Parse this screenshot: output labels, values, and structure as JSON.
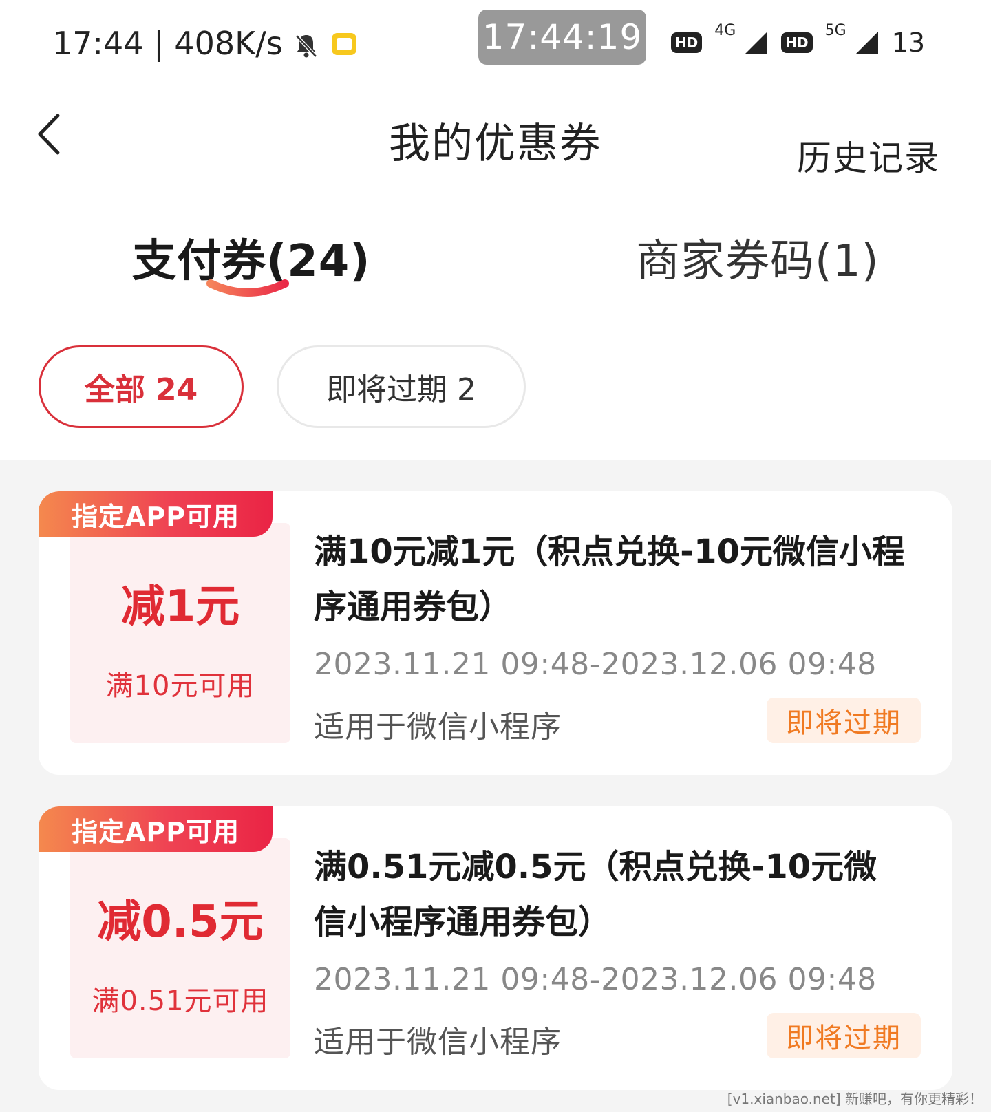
{
  "status_bar": {
    "time_speed": "17:44 | 408K/s",
    "clock": "17:44:19",
    "hd_1": "HD",
    "net_1": "4G",
    "hd_2": "HD",
    "net_2": "5G",
    "battery": "13",
    "icons": [
      "bell-muted-icon",
      "note-icon",
      "signal-icon"
    ]
  },
  "header": {
    "title": "我的优惠券",
    "history": "历史记录",
    "back_icon": "chevron-left-icon"
  },
  "tabs": [
    {
      "label": "支付券(24)",
      "active": true
    },
    {
      "label": "商家券码(1)",
      "active": false
    }
  ],
  "filters": [
    {
      "label": "全部 24",
      "active": true
    },
    {
      "label": "即将过期 2",
      "active": false
    }
  ],
  "coupons": [
    {
      "tag": "指定APP可用",
      "discount": "减1元",
      "threshold": "满10元可用",
      "title": "满10元减1元（积点兑换-10元微信小程序通用券包）",
      "validity": "2023.11.21 09:48-2023.12.06 09:48",
      "scope": "适用于微信小程序",
      "badge": "即将过期"
    },
    {
      "tag": "指定APP可用",
      "discount": "减0.5元",
      "threshold": "满0.51元可用",
      "title": "满0.51元减0.5元（积点兑换-10元微信小程序通用券包）",
      "validity": "2023.11.21 09:48-2023.12.06 09:48",
      "scope": "适用于微信小程序",
      "badge": "即将过期"
    }
  ],
  "watermark": "[v1.xianbao.net] 新赚吧，有你更精彩！",
  "colors": {
    "accent_red": "#d9303a",
    "badge_orange": "#f07a22",
    "badge_bg": "#fff0e6",
    "list_bg": "#f4f4f4"
  }
}
